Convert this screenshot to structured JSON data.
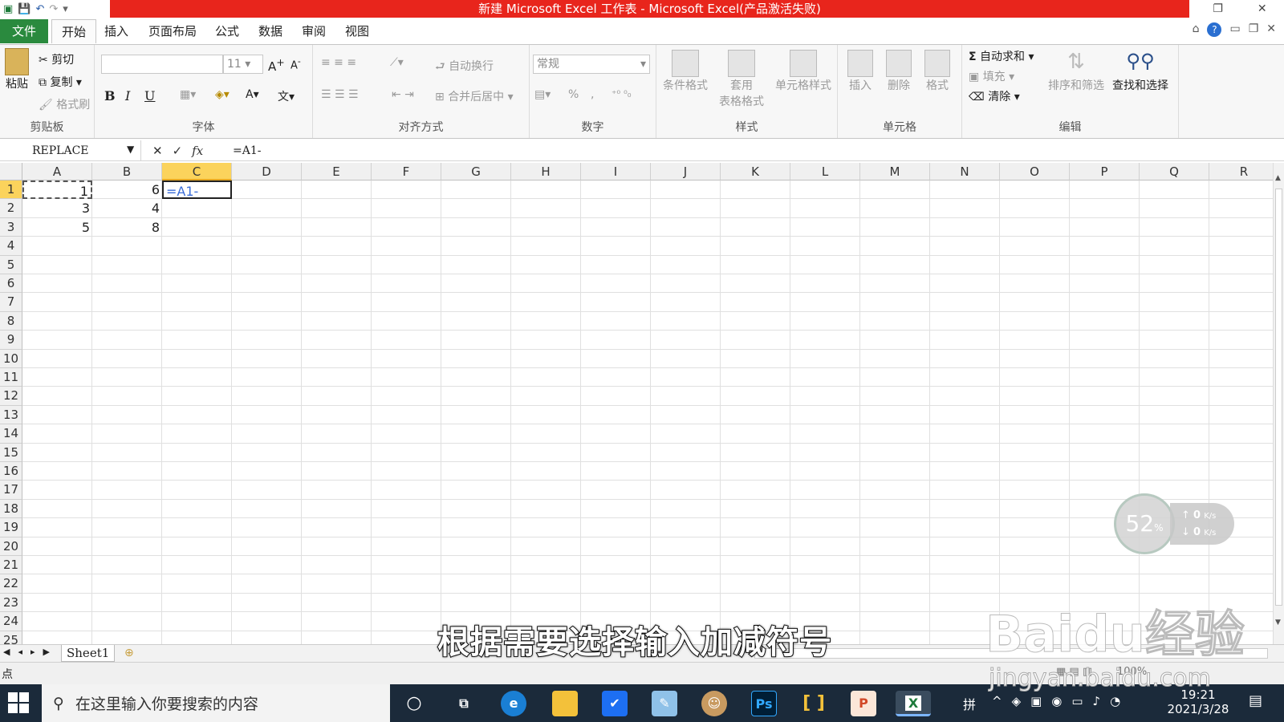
{
  "window": {
    "title": "新建 Microsoft Excel 工作表 - Microsoft Excel(产品激活失败)"
  },
  "ribbon_tabs": [
    "文件",
    "开始",
    "插入",
    "页面布局",
    "公式",
    "数据",
    "审阅",
    "视图"
  ],
  "clipboard": {
    "paste": "粘贴",
    "cut": "剪切",
    "copy": "复制",
    "format_painter": "格式刷",
    "label": "剪贴板"
  },
  "font": {
    "size": "11",
    "bold": "B",
    "italic": "I",
    "underline": "U",
    "label": "字体"
  },
  "alignment": {
    "wrap": "自动换行",
    "merge": "合并后居中",
    "label": "对齐方式"
  },
  "number": {
    "format": "常规",
    "percent": "%",
    "comma": ",",
    "label": "数字"
  },
  "styles": {
    "conditional": "条件格式",
    "table_1": "套用",
    "table_2": "表格格式",
    "cell_styles": "单元格样式",
    "label": "样式"
  },
  "cells": {
    "insert": "插入",
    "delete": "删除",
    "format": "格式",
    "label": "单元格"
  },
  "editing": {
    "autosum": "自动求和",
    "fill": "填充",
    "clear": "清除",
    "sort": "排序和筛选",
    "find": "查找和选择",
    "label": "编辑"
  },
  "formula_bar": {
    "name_box": "REPLACE",
    "fx": "fx",
    "formula": "=A1-"
  },
  "columns": [
    "A",
    "B",
    "C",
    "D",
    "E",
    "F",
    "G",
    "H",
    "I",
    "J",
    "K",
    "L",
    "M",
    "N",
    "O",
    "P",
    "Q",
    "R"
  ],
  "rows": [
    "1",
    "2",
    "3",
    "4",
    "5",
    "6",
    "7",
    "8",
    "9",
    "10",
    "11",
    "12",
    "13",
    "14",
    "15",
    "16",
    "17",
    "18",
    "19",
    "20",
    "21",
    "22",
    "23",
    "24",
    "25"
  ],
  "cells_data": {
    "A1": "1",
    "B1": "6",
    "C1": "=A1-",
    "A2": "3",
    "B2": "4",
    "A3": "5",
    "B3": "8"
  },
  "sheet_tab": "Sheet1",
  "status": {
    "mode": "点",
    "zoom": "100%"
  },
  "overlay": {
    "subtitle": "根据需要选择输入加减符号",
    "speed_percent": "52",
    "speed_unit": "%",
    "up": "0",
    "down": "0",
    "rate_unit": "K/s",
    "watermark": "Baidu经验",
    "watermark_url": "jingyan.baidu.com"
  },
  "taskbar": {
    "search_placeholder": "在这里输入你要搜索的内容",
    "ime": "拼",
    "time": "19:21",
    "date": "2021/3/28"
  },
  "colors": {
    "title_red": "#e8251c",
    "file_tab": "#2a8a3e",
    "selected_header": "#fbd35c",
    "taskbar": "#1b2a3a"
  }
}
